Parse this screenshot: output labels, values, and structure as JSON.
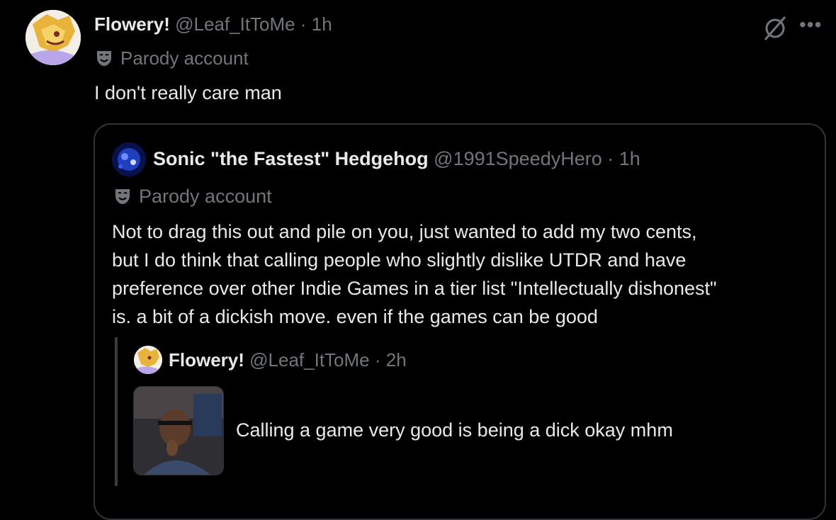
{
  "post": {
    "author_name": "Flowery!",
    "handle": "@Leaf_ItToMe",
    "separator": "·",
    "time": "1h",
    "badge": "Parody account",
    "text": "I don't really care man",
    "icons": {
      "grok": "grok-icon",
      "more": "more-options-icon",
      "badge": "theater-mask-icon"
    }
  },
  "quote": {
    "author_name": "Sonic \"the Fastest\" Hedgehog",
    "handle": "@1991SpeedyHero",
    "separator": "·",
    "time": "1h",
    "badge": "Parody account",
    "text_lines": [
      "Not to drag this out and pile on you, just wanted to add my two cents,",
      "but I do think that calling people who slightly dislike UTDR and have",
      "preference over other Indie Games in a tier list \"Intellectually dishonest\"",
      "is. a bit of a dickish move. even if the games can be good"
    ]
  },
  "nested_quote": {
    "author_name": "Flowery!",
    "handle": "@Leaf_ItToMe",
    "separator": "·",
    "time": "2h",
    "text": "Calling a game very good is being a dick okay mhm"
  },
  "colors": {
    "background": "#000000",
    "text": "#e7e9ea",
    "muted": "#71767b",
    "border": "#2f3336"
  }
}
